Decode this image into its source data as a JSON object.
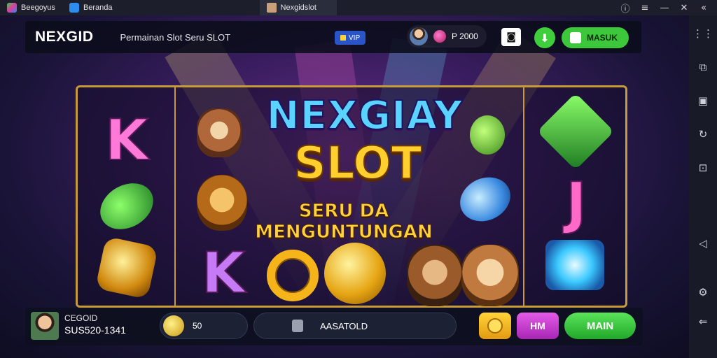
{
  "window": {
    "tabs": [
      {
        "label": "Beegoyus",
        "icon": "app-logo-icon"
      },
      {
        "label": "Beranda",
        "icon": "home-icon"
      },
      {
        "label": "Nexgidslot",
        "icon": "avatar-icon"
      }
    ],
    "controls": [
      "info-icon",
      "menu-icon",
      "minimize-icon",
      "close-icon",
      "collapse-icon"
    ]
  },
  "header": {
    "logo": "NEXGID",
    "subtitle": "Permainan Slot Seru SLOT",
    "badge": "VIP",
    "balance": "P 2000",
    "login_label": "MASUK"
  },
  "banner": {
    "title": "NEXGIAY",
    "slot": "SLOT",
    "tagline": "SERU DA MENGUNTUNGAN"
  },
  "reel_symbols": {
    "left_top": "K",
    "center_bottom_left": "K",
    "right_middle": "J"
  },
  "footer": {
    "player_name": "CEGOID",
    "player_id": "SUS520-1341",
    "bet_label": "50",
    "auto_label": "AASATOLD",
    "action_label": "HM",
    "spin_label": "MAIN"
  },
  "rightbar": {
    "icons": [
      "grid-icon",
      "screen-icon",
      "camera-icon",
      "rotate-icon",
      "import-icon",
      "back-arrow-icon",
      "settings-icon",
      "return-icon"
    ]
  },
  "colors": {
    "accent_gold": "#c79a3a",
    "play_green": "#3cc83a",
    "magenta": "#d03fd8"
  }
}
